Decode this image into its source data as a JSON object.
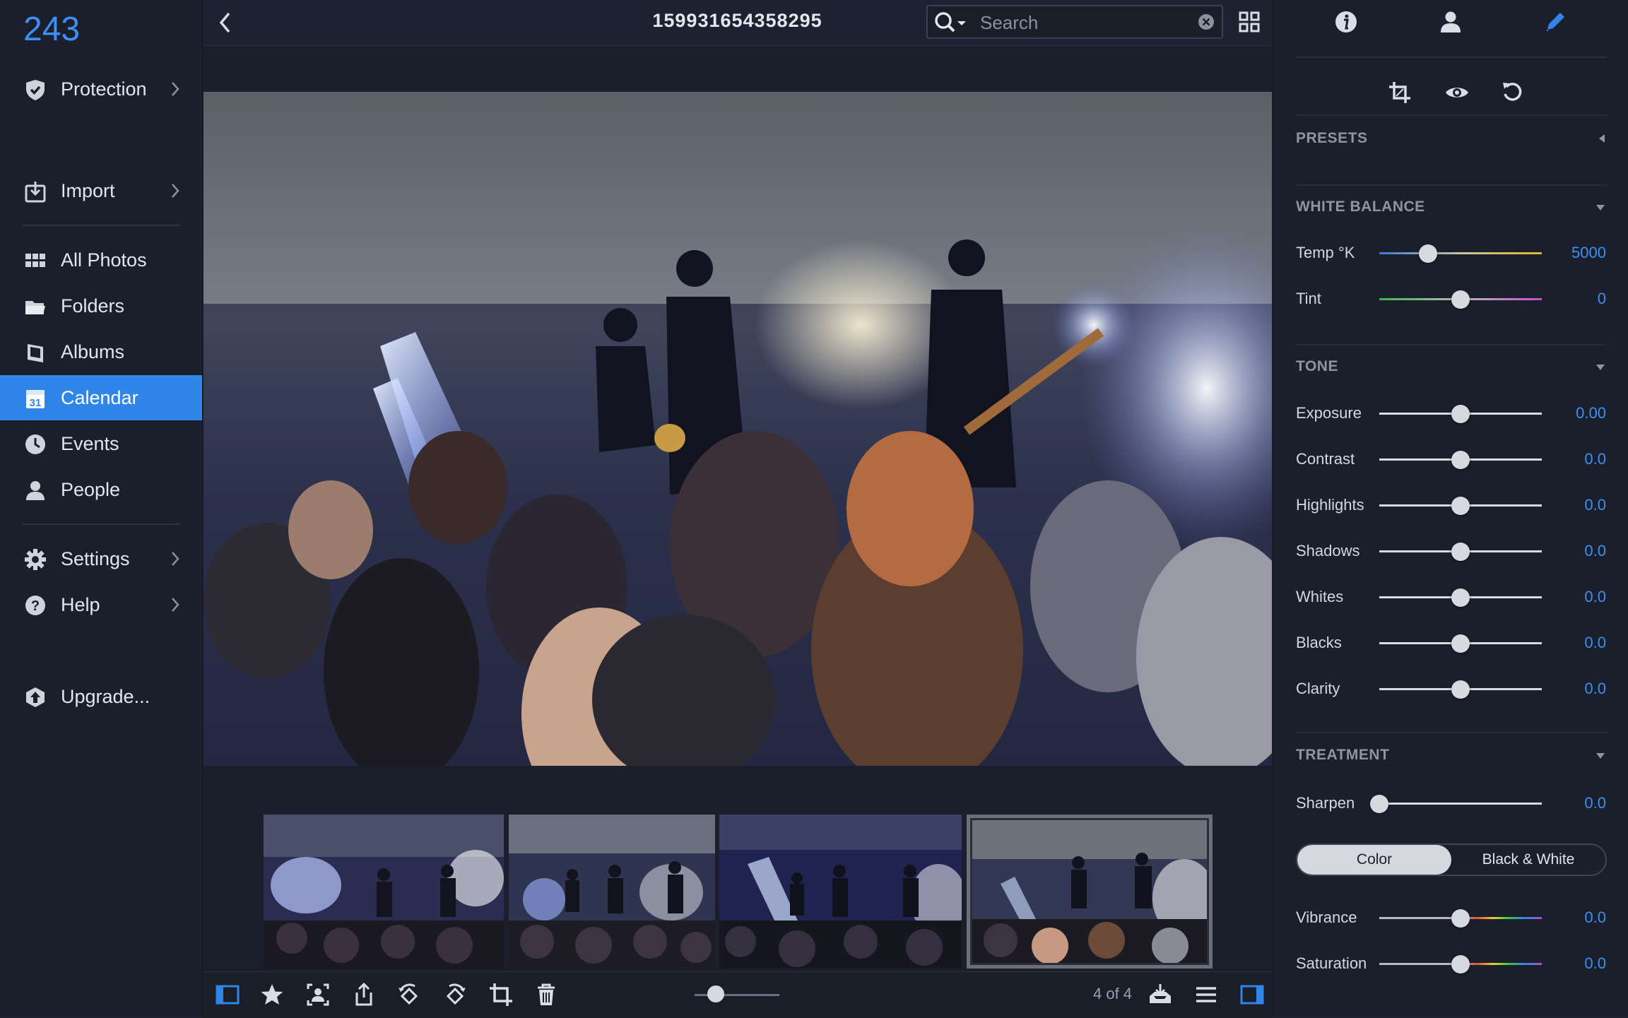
{
  "sidebar": {
    "count": "243",
    "items": [
      {
        "label": "Protection",
        "icon": "shield-check-icon"
      },
      {
        "label": "Import",
        "icon": "import-icon"
      },
      {
        "label": "All Photos",
        "icon": "grid-icon"
      },
      {
        "label": "Folders",
        "icon": "folder-icon"
      },
      {
        "label": "Albums",
        "icon": "album-icon"
      },
      {
        "label": "Calendar",
        "icon": "calendar-icon",
        "calendar_day": "31"
      },
      {
        "label": "Events",
        "icon": "clock-icon"
      },
      {
        "label": "People",
        "icon": "person-icon"
      },
      {
        "label": "Settings",
        "icon": "gear-icon"
      },
      {
        "label": "Help",
        "icon": "help-icon"
      },
      {
        "label": "Upgrade...",
        "icon": "upgrade-icon"
      }
    ],
    "active_item": "Calendar"
  },
  "header": {
    "title": "159931654358295",
    "search_placeholder": "Search"
  },
  "viewer": {
    "thumbnail_count": 4,
    "selected_thumbnail": 4
  },
  "bottom_toolbar": {
    "pager": "4 of 4",
    "zoom_level": 0.25
  },
  "panel": {
    "tabs": [
      "info-icon",
      "person-icon",
      "pencil-icon"
    ],
    "tools": [
      "crop-icon",
      "eye-icon",
      "reset-icon"
    ],
    "sections": {
      "presets": "PRESETS",
      "white_balance": "WHITE BALANCE",
      "tone": "TONE",
      "treatment": "TREATMENT"
    },
    "white_balance": [
      {
        "name": "Temp °K",
        "value": "5000",
        "level": 0.3
      },
      {
        "name": "Tint",
        "value": "0",
        "level": 0.5
      }
    ],
    "tone": [
      {
        "name": "Exposure",
        "value": "0.00",
        "level": 0.5
      },
      {
        "name": "Contrast",
        "value": "0.0",
        "level": 0.5
      },
      {
        "name": "Highlights",
        "value": "0.0",
        "level": 0.5
      },
      {
        "name": "Shadows",
        "value": "0.0",
        "level": 0.5
      },
      {
        "name": "Whites",
        "value": "0.0",
        "level": 0.5
      },
      {
        "name": "Blacks",
        "value": "0.0",
        "level": 0.5
      },
      {
        "name": "Clarity",
        "value": "0.0",
        "level": 0.5
      }
    ],
    "treatment": [
      {
        "name": "Sharpen",
        "value": "0.0",
        "level": 0.0
      }
    ],
    "color_mode": {
      "options": [
        "Color",
        "Black & White"
      ],
      "selected": "Color"
    },
    "color": [
      {
        "name": "Vibrance",
        "value": "0.0",
        "level": 0.5
      },
      {
        "name": "Saturation",
        "value": "0.0",
        "level": 0.5
      }
    ]
  },
  "colors": {
    "accent": "#2f86e8",
    "value_blue": "#3b8ff5",
    "background": "#1d2230"
  }
}
